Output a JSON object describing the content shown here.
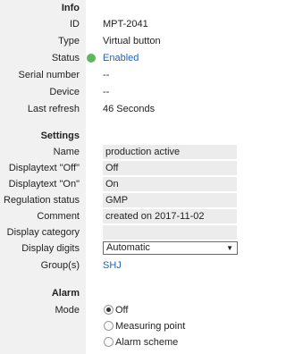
{
  "info": {
    "heading": "Info",
    "id_label": "ID",
    "id_value": "MPT-2041",
    "type_label": "Type",
    "type_value": "Virtual button",
    "status_label": "Status",
    "status_value": "Enabled",
    "status_color": "#5cb85c",
    "serial_label": "Serial number",
    "serial_value": "--",
    "device_label": "Device",
    "device_value": "--",
    "refresh_label": "Last refresh",
    "refresh_value": "46 Seconds"
  },
  "settings": {
    "heading": "Settings",
    "name_label": "Name",
    "name_value": "production active",
    "off_label": "Displaytext \"Off\"",
    "off_value": "Off",
    "on_label": "Displaytext \"On\"",
    "on_value": "On",
    "regulation_label": "Regulation status",
    "regulation_value": "GMP",
    "comment_label": "Comment",
    "comment_value": "created on 2017-11-02",
    "category_label": "Display category",
    "category_value": "",
    "digits_label": "Display digits",
    "digits_value": "Automatic",
    "digits_arrow": "▼",
    "groups_label": "Group(s)",
    "groups_value": "SHJ"
  },
  "alarm": {
    "heading": "Alarm",
    "mode_label": "Mode",
    "options": [
      "Off",
      "Measuring point",
      "Alarm scheme"
    ],
    "selected": "Off"
  },
  "colors": {
    "link": "#1f64b4",
    "gutter": "#f1f1f1",
    "field": "#ececec"
  }
}
